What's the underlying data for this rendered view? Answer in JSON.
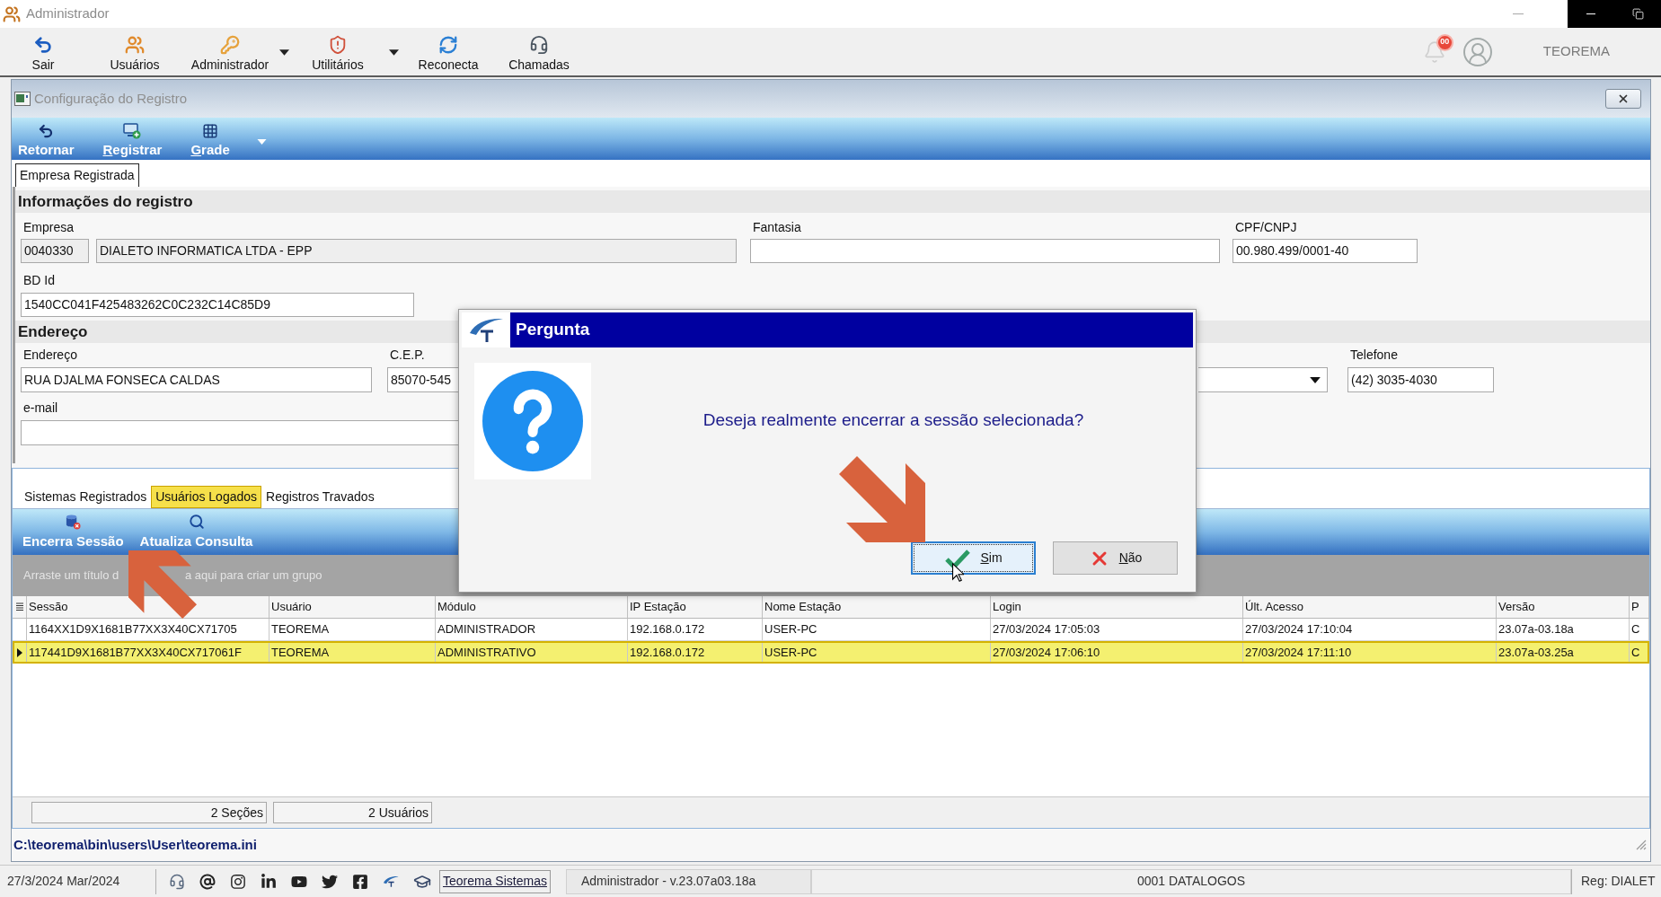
{
  "window": {
    "title": "Administrador"
  },
  "toolbar": {
    "items": [
      {
        "label": "Sair",
        "kind": "exit",
        "dropdown": false
      },
      {
        "label": "Usuários",
        "kind": "users",
        "dropdown": false
      },
      {
        "label": "Administrador",
        "kind": "key",
        "dropdown": true
      },
      {
        "label": "Utilitários",
        "kind": "tools",
        "dropdown": true
      },
      {
        "label": "Reconecta",
        "kind": "reconnect",
        "dropdown": false
      },
      {
        "label": "Chamadas",
        "kind": "support",
        "dropdown": false
      }
    ],
    "notification_count": "00",
    "user": "TEOREMA"
  },
  "child_window": {
    "title": "Configuração do Registro",
    "ribbon": [
      {
        "label": "Retornar",
        "kind": "back",
        "mnemonic": false,
        "dropdown": false
      },
      {
        "label": "Registrar",
        "kind": "register",
        "mnemonic": true,
        "dropdown": false
      },
      {
        "label": "Grade",
        "kind": "grid",
        "mnemonic": true,
        "dropdown": true
      }
    ],
    "tabs": [
      {
        "label": "Empresa Registrada",
        "selected": true
      }
    ],
    "registro": {
      "title": "Informações do registro",
      "empresa": {
        "label": "Empresa",
        "code": "0040330",
        "name": "DIALETO INFORMATICA LTDA - EPP",
        "readonly": true
      },
      "fantasia": {
        "label": "Fantasia"
      },
      "cpf_cnpj": {
        "label": "CPF/CNPJ",
        "value": "00.980.499/0001-40"
      },
      "bd_id": {
        "label": "BD Id",
        "value": "1540CC041F425483262C0C232C14C85D9"
      }
    },
    "endereco": {
      "title": "Endereço",
      "endereco": {
        "label": "Endereço",
        "value": "RUA DJALMA FONSECA CALDAS"
      },
      "cep": {
        "label": "C.E.P.",
        "value": "85070-545"
      },
      "telefone": {
        "label": "Telefone",
        "value": "(42) 3035-4030"
      },
      "email": {
        "label": "e-mail"
      }
    },
    "sessions_panel": {
      "tabs": [
        {
          "label": "Sistemas Registrados",
          "selected": false
        },
        {
          "label": "Usuários Logados",
          "selected": true
        },
        {
          "label": "Registros Travados",
          "selected": false
        }
      ],
      "ribbon": [
        {
          "label": "Encerra Sessão",
          "kind": "end_session"
        },
        {
          "label": "Atualiza Consulta",
          "kind": "refresh"
        }
      ],
      "group_hint_parts": [
        "Arraste um título d",
        "a aqui para criar um grupo"
      ],
      "table": {
        "columns": [
          "Sessão",
          "Usuário",
          "Módulo",
          "IP Estação",
          "Nome Estação",
          "Login",
          "Últ. Acesso",
          "Versão",
          "P"
        ],
        "rows": [
          {
            "selected": false,
            "cells": [
              "1164XX1D9X1681B77XX3X40CX71705",
              "TEOREMA",
              "ADMINISTRADOR",
              "192.168.0.172",
              "USER-PC",
              "27/03/2024 17:05:03",
              "27/03/2024 17:10:04",
              "23.07a-03.18a",
              "C"
            ]
          },
          {
            "selected": true,
            "cells": [
              "117441D9X1681B77XX3X40CX717061F",
              "TEOREMA",
              "ADMINISTRATIVO",
              "192.168.0.172",
              "USER-PC",
              "27/03/2024 17:06:10",
              "27/03/2024 17:11:10",
              "23.07a-03.25a",
              "C"
            ]
          }
        ]
      },
      "summary": [
        "2 Seções",
        "2 Usuários"
      ]
    },
    "path": "C:\\teorema\\bin\\users\\User\\teorema.ini"
  },
  "dialog": {
    "title": "Pergunta",
    "message": "Deseja realmente encerrar a sessão selecionada?",
    "buttons": [
      {
        "label": "Sim",
        "kind": "yes",
        "focused": true,
        "mnemonic": true
      },
      {
        "label": "Não",
        "kind": "no",
        "focused": false,
        "mnemonic": true
      }
    ]
  },
  "status_bar": {
    "date": "27/3/2024 Mar/2024",
    "link": "Teorema Sistemas",
    "session_info": "Administrador - v.23.07a03.18a",
    "company": "0001 DATALOGOS",
    "registration": "Reg: DIALET"
  }
}
